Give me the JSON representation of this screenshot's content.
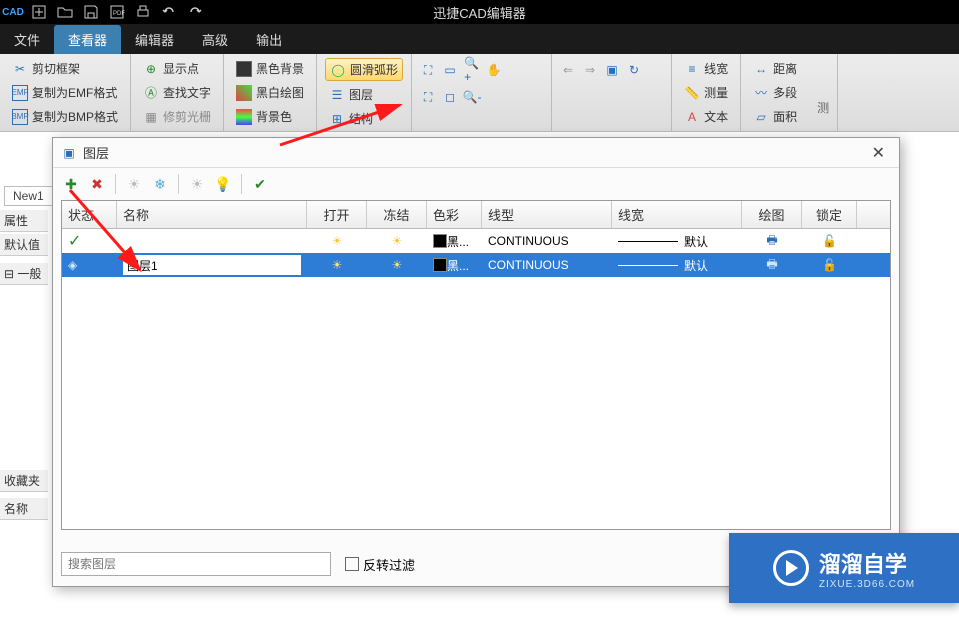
{
  "app": {
    "title": "迅捷CAD编辑器"
  },
  "menu": {
    "file": "文件",
    "view": "查看器",
    "editor": "编辑器",
    "advanced": "高级",
    "output": "输出"
  },
  "ribbon": {
    "group1": {
      "clip_frame": "剪切框架",
      "copy_emf": "复制为EMF格式",
      "copy_bmp": "复制为BMP格式"
    },
    "group2": {
      "show_point": "显示点",
      "find_text": "查找文字",
      "edit_hatch": "修剪光栅"
    },
    "group3": {
      "black_bg": "黑色背景",
      "bw_draw": "黑白绘图",
      "bg_color": "背景色"
    },
    "group4": {
      "smooth_arc": "圆滑弧形",
      "layers": "图层",
      "structure": "结构"
    },
    "group5": {
      "lineweight": "线宽",
      "measure": "测量",
      "text": "文本"
    },
    "group6": {
      "distance": "距离",
      "polyline": "多段",
      "area": "面积"
    }
  },
  "doc_tab": "New1",
  "left_panels": {
    "properties": "属性",
    "default": "默认值",
    "general": "一般",
    "favorites": "收藏夹",
    "name": "名称"
  },
  "dialog": {
    "title": "图层",
    "columns": {
      "state": "状态",
      "name": "名称",
      "open": "打开",
      "freeze": "冻结",
      "color": "色彩",
      "linetype": "线型",
      "lineweight": "线宽",
      "plot": "绘图",
      "lock": "锁定"
    },
    "rows": [
      {
        "state_icon": "✓",
        "name": "",
        "color_name": "黑...",
        "linetype": "CONTINUOUS",
        "lineweight": "默认",
        "selected": false
      },
      {
        "state_icon": "◆",
        "name": "图层1",
        "color_name": "黑...",
        "linetype": "CONTINUOUS",
        "lineweight": "默认",
        "selected": true
      }
    ],
    "search_placeholder": "搜索图层",
    "invert_filter": "反转过滤"
  },
  "watermark": {
    "main": "溜溜自学",
    "sub": "ZIXUE.3D66.COM"
  }
}
